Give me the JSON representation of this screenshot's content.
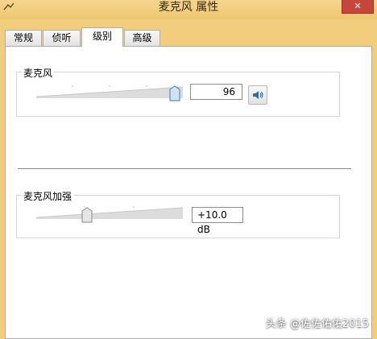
{
  "window": {
    "title": "麦克风 属性",
    "close_label": "✕",
    "frame_color": "#f2cd7d"
  },
  "tabs": [
    {
      "label": "常规",
      "active": false
    },
    {
      "label": "侦听",
      "active": false
    },
    {
      "label": "级别",
      "active": true
    },
    {
      "label": "高级",
      "active": false
    }
  ],
  "microphone": {
    "group_label": "麦克风",
    "level": 96,
    "level_text": "96",
    "speaker_icon": "speaker-icon"
  },
  "boost": {
    "group_label": "麦克风加强",
    "value_text": "+10.0 dB",
    "level_fraction": 0.33
  },
  "watermark": "头条 @佐佐佑佑2015"
}
